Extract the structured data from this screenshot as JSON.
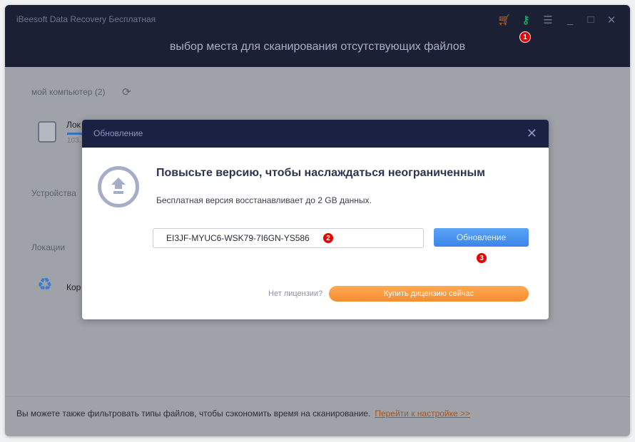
{
  "app": {
    "title": "iBeesoft Data Recovery Бесплатная",
    "heading": "выбор места для сканирования отсутствующих файлов"
  },
  "controls": {
    "cart": "cart-icon",
    "key": "key-icon",
    "menu": "menu-icon",
    "minimize": "minimize-icon",
    "maximize": "maximize-icon",
    "close": "close-icon"
  },
  "badges": [
    "1",
    "2",
    "3"
  ],
  "sidebar": {
    "my_computer": "мой компьютер (2)",
    "drive_name": "Лок",
    "drive_size": "103.",
    "devices": "Устройства",
    "locations": "Локации",
    "recycle": "Кор"
  },
  "dialog": {
    "title": "Обновление",
    "heading": "Повысьте версию, чтобы наслаждаться неограниченным",
    "subtitle": "Бесплатная версия восстанавливает до 2 GB данных.",
    "license_key": "EI3JF-MYUC6-WSK79-7I6GN-YS586",
    "upgrade_button": "Обновление",
    "no_license": "Нет лицензии?",
    "buy_button": "Купить дицензию сейчас"
  },
  "footer": {
    "text": "Вы можете также фильтровать типы файлов, чтобы сэкономить время на сканирование.",
    "link": "Перейти к настройке >>"
  },
  "colors": {
    "header": "#1c2035",
    "accent_blue": "#3a86ea",
    "accent_orange": "#f58d2e",
    "badge": "#e00000"
  }
}
